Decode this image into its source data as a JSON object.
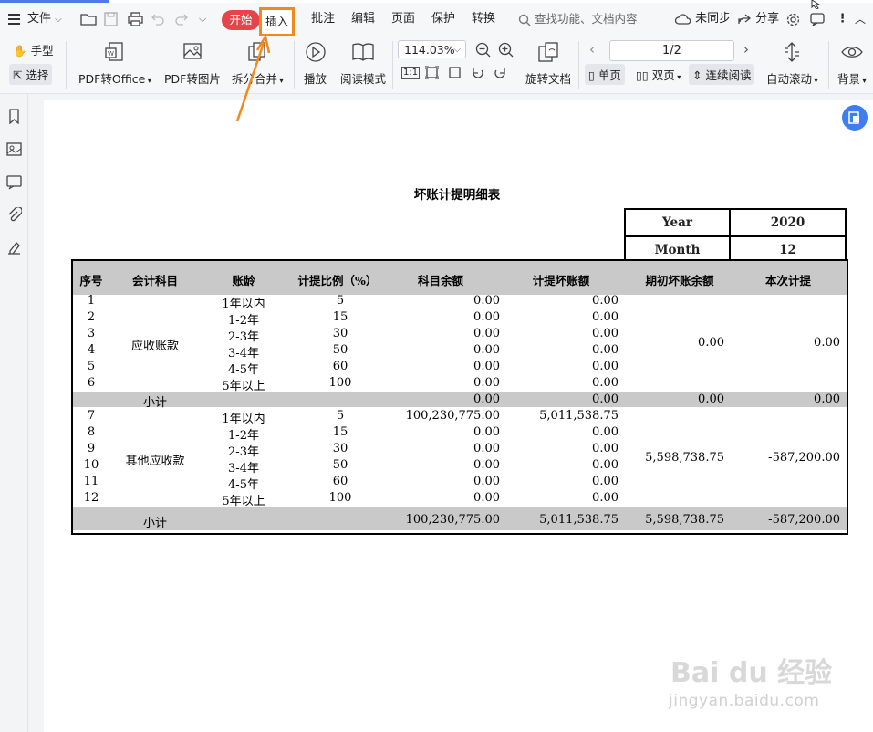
{
  "menubar": {
    "file": "文件",
    "tabs": [
      "开始",
      "插入",
      "批注",
      "编辑",
      "页面",
      "保护",
      "转换"
    ],
    "search_placeholder": "查找功能、文档内容",
    "sync": "未同步",
    "share": "分享"
  },
  "toolbar": {
    "hand": "手型",
    "select": "选择",
    "pdf_to_office": "PDF转Office",
    "pdf_to_image": "PDF转图片",
    "split_merge": "拆分合并",
    "play": "播放",
    "read_mode": "阅读模式",
    "zoom": "114.03%",
    "rotate_doc": "旋转文档",
    "page_indicator": "1/2",
    "single_page": "单页",
    "double_page": "双页",
    "continuous": "连续阅读",
    "auto_scroll": "自动滚动",
    "background": "背景",
    "fit_label": "1:1"
  },
  "document": {
    "title": "坏账计提明细表",
    "year_label": "Year",
    "year_value": "2020",
    "month_label": "Month",
    "month_value": "12",
    "headers": [
      "序号",
      "会计科目",
      "账龄",
      "计提比例（%）",
      "科目余额",
      "计提坏账额",
      "期初坏账余额",
      "本次计提"
    ],
    "group1": {
      "account": "应收账款",
      "rows": [
        {
          "no": "1",
          "age": "1年以内",
          "rate": "5",
          "balance": "0.00",
          "provision": "0.00"
        },
        {
          "no": "2",
          "age": "1-2年",
          "rate": "15",
          "balance": "0.00",
          "provision": "0.00"
        },
        {
          "no": "3",
          "age": "2-3年",
          "rate": "30",
          "balance": "0.00",
          "provision": "0.00"
        },
        {
          "no": "4",
          "age": "3-4年",
          "rate": "50",
          "balance": "0.00",
          "provision": "0.00"
        },
        {
          "no": "5",
          "age": "4-5年",
          "rate": "60",
          "balance": "0.00",
          "provision": "0.00"
        },
        {
          "no": "6",
          "age": "5年以上",
          "rate": "100",
          "balance": "0.00",
          "provision": "0.00"
        }
      ],
      "opening": "0.00",
      "current": "0.00",
      "subtotal": {
        "label": "小计",
        "balance": "0.00",
        "provision": "0.00",
        "opening": "0.00",
        "current": "0.00"
      }
    },
    "group2": {
      "account": "其他应收款",
      "rows": [
        {
          "no": "7",
          "age": "1年以内",
          "rate": "5",
          "balance": "100,230,775.00",
          "provision": "5,011,538.75"
        },
        {
          "no": "8",
          "age": "1-2年",
          "rate": "15",
          "balance": "0.00",
          "provision": "0.00"
        },
        {
          "no": "9",
          "age": "2-3年",
          "rate": "30",
          "balance": "0.00",
          "provision": "0.00"
        },
        {
          "no": "10",
          "age": "3-4年",
          "rate": "50",
          "balance": "0.00",
          "provision": "0.00"
        },
        {
          "no": "11",
          "age": "4-5年",
          "rate": "60",
          "balance": "0.00",
          "provision": "0.00"
        },
        {
          "no": "12",
          "age": "5年以上",
          "rate": "100",
          "balance": "0.00",
          "provision": "0.00"
        }
      ],
      "opening": "5,598,738.75",
      "current": "-587,200.00",
      "subtotal": {
        "label": "小计",
        "balance": "100,230,775.00",
        "provision": "5,011,538.75",
        "opening": "5,598,738.75",
        "current": "-587,200.00"
      }
    }
  },
  "watermark": {
    "brand": "Bai du 经验",
    "url": "jingyan.baidu.com"
  },
  "colors": {
    "start_tab": "#e5454a",
    "highlight_box": "#f08a1c",
    "subtotal_bg": "#c9c9c9",
    "fab": "#3d7ef0"
  },
  "icons": [
    "menu-icon",
    "folder-icon",
    "save-icon",
    "print-icon",
    "undo-icon",
    "redo-icon",
    "dropdown-icon",
    "search-icon",
    "cloud-icon",
    "share-icon",
    "gear-icon",
    "comment-icon",
    "more-icon",
    "collapse-icon",
    "hand-icon",
    "cursor-icon",
    "pdf-office-icon",
    "pdf-image-icon",
    "split-merge-icon",
    "play-icon",
    "book-icon",
    "zoom-out-icon",
    "zoom-in-icon",
    "rotate-doc-icon",
    "prev-page-icon",
    "next-page-icon",
    "single-page-icon",
    "double-page-icon",
    "continuous-icon",
    "auto-scroll-icon",
    "eye-icon",
    "bookmark-icon",
    "image-icon",
    "annotation-icon",
    "attachment-icon",
    "sign-icon"
  ]
}
